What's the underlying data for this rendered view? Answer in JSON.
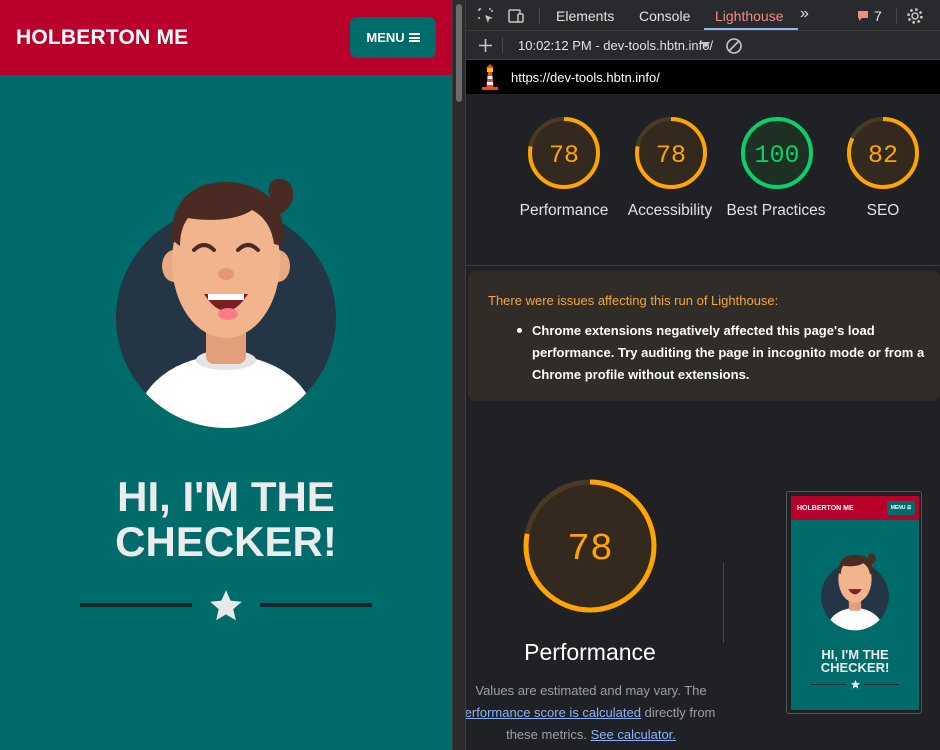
{
  "site": {
    "brand": "HOLBERTON ME",
    "menu_label": "MENU",
    "heading_line1": "HI, I'M THE",
    "heading_line2": "CHECKER!"
  },
  "devtools": {
    "tabs": [
      "Elements",
      "Console",
      "Lighthouse"
    ],
    "active_tab": "Lighthouse",
    "more_tabs_glyph": "»",
    "issues_count": "7",
    "report_select": "10:02:12 PM - dev-tools.hbtn.info/",
    "url": "https://dev-tools.hbtn.info/",
    "scores": [
      {
        "label": "Performance",
        "value": "78",
        "color": "#ffa400"
      },
      {
        "label": "Accessibility",
        "value": "78",
        "color": "#ffa400"
      },
      {
        "label": "Best Practices",
        "value": "100",
        "color": "#0cce6b"
      },
      {
        "label": "SEO",
        "value": "82",
        "color": "#ffa400"
      }
    ],
    "warning_title": "There were issues affecting this run of Lighthouse:",
    "warning_item": "Chrome extensions negatively affected this page's load performance. Try auditing the page in incognito mode or from a Chrome profile without extensions.",
    "big_score": {
      "label": "Performance",
      "value": "78"
    },
    "note_line1": "Values are estimated and may vary. The",
    "note_link1": "Performance score is calculated",
    "note_line2_tail": " directly from",
    "note_line3_head": "these metrics. ",
    "note_link2": "See calculator.",
    "thumbnail": {
      "brand": "HOLBERTON ME",
      "menu": "MENU ☰",
      "heading_line1": "HI, I'M THE",
      "heading_line2": "CHECKER!"
    }
  },
  "colors": {
    "nav_red": "#b8002b",
    "teal": "#006b6b",
    "warning_orange": "#f5a53b",
    "score_orange": "#ffa400",
    "score_green": "#0cce6b",
    "link_blue": "#8ab4f8"
  },
  "icons": [
    "inspect-icon",
    "device-toolbar-icon",
    "more-tabs-icon",
    "issues-icon",
    "settings-gear-icon",
    "add-icon",
    "dropdown-caret-icon",
    "clear-icon",
    "lighthouse-logo-icon",
    "star-icon"
  ]
}
